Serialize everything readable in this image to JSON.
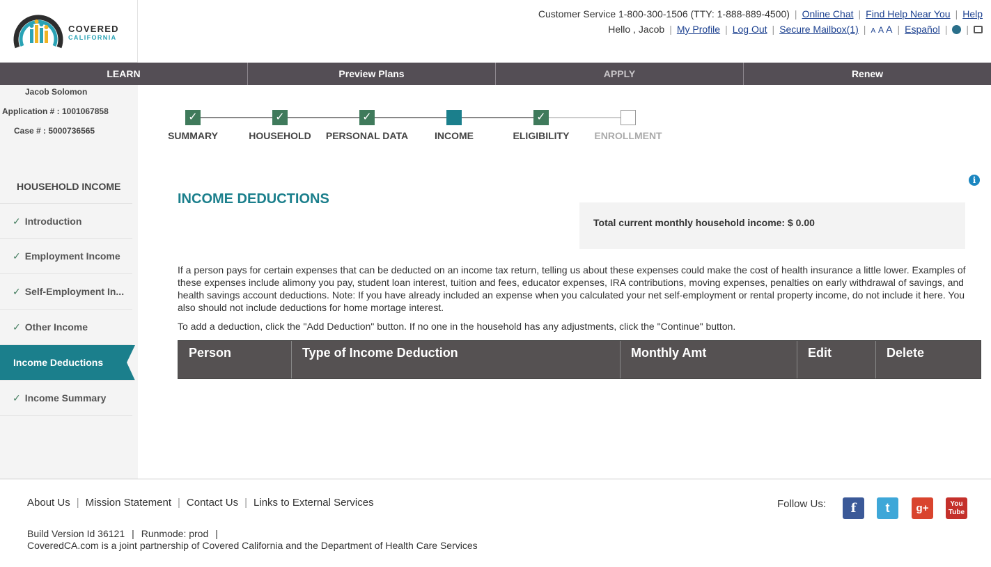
{
  "logo": {
    "name1": "COVERED",
    "name2": "CALIFORNIA"
  },
  "header": {
    "customer_service": "Customer Service 1-800-300-1506 (TTY: 1-888-889-4500)",
    "online_chat": "Online Chat",
    "find_help": "Find Help Near You",
    "help": "Help",
    "greeting": "Hello , Jacob",
    "my_profile": "My Profile",
    "log_out": "Log Out",
    "secure_mailbox": "Secure Mailbox(1)",
    "text_size_small": "A",
    "text_size_medium": "A",
    "text_size_large": "A",
    "espanol": "Español"
  },
  "nav": {
    "items": [
      {
        "label": "LEARN"
      },
      {
        "label": "Preview Plans"
      },
      {
        "label": "APPLY"
      },
      {
        "label": "Renew"
      }
    ]
  },
  "applicant": {
    "name": "Jacob Solomon",
    "application": "Application # : 1001067858",
    "case": "Case # : 5000736565"
  },
  "sidebar": {
    "heading": "HOUSEHOLD INCOME",
    "items": [
      {
        "label": "Introduction"
      },
      {
        "label": "Employment Income"
      },
      {
        "label": "Self-Employment In..."
      },
      {
        "label": "Other Income"
      },
      {
        "label": "Income Deductions"
      },
      {
        "label": "Income Summary"
      }
    ]
  },
  "progress": {
    "steps": [
      {
        "label": "SUMMARY",
        "state": "complete"
      },
      {
        "label": "HOUSEHOLD",
        "state": "complete"
      },
      {
        "label": "PERSONAL DATA",
        "state": "complete"
      },
      {
        "label": "INCOME",
        "state": "current"
      },
      {
        "label": "ELIGIBILITY",
        "state": "complete"
      },
      {
        "label": "ENROLLMENT",
        "state": "incomplete"
      }
    ]
  },
  "main": {
    "title": "INCOME DEDUCTIONS",
    "total_income": "Total current monthly household income: $ 0.00",
    "description": "If a person pays for certain expenses that can be deducted on an income tax return, telling us about these expenses could make the cost of health insurance a little lower. Examples of these expenses include alimony you pay, student loan interest, tuition and fees, educator expenses, IRA contributions, moving expenses, penalties on early withdrawal of savings, and health savings account deductions. Note: If you have already included an expense when you calculated your net self-employment or rental property income, do not include it here. You also should not include deductions for home mortage interest.",
    "instruction": "To add a deduction, click the \"Add Deduction\" button. If no one in the household has any adjustments, click the \"Continue\" button.",
    "table_headers": [
      "Person",
      "Type of Income Deduction",
      "Monthly Amt",
      "Edit",
      "Delete"
    ]
  },
  "footer": {
    "links": [
      "About Us",
      "Mission Statement",
      "Contact Us",
      "Links to External Services"
    ],
    "follow_us": "Follow Us:",
    "build": "Build Version Id 36121",
    "runmode": "Runmode: prod",
    "partnership": "CoveredCA.com is a joint partnership of Covered California and the Department of Health Care Services"
  },
  "colors": {
    "teal": "#1b7f8c",
    "nav_bg": "#544e55",
    "check_green": "#3f7a5b",
    "link_blue": "#1a3f8f"
  }
}
